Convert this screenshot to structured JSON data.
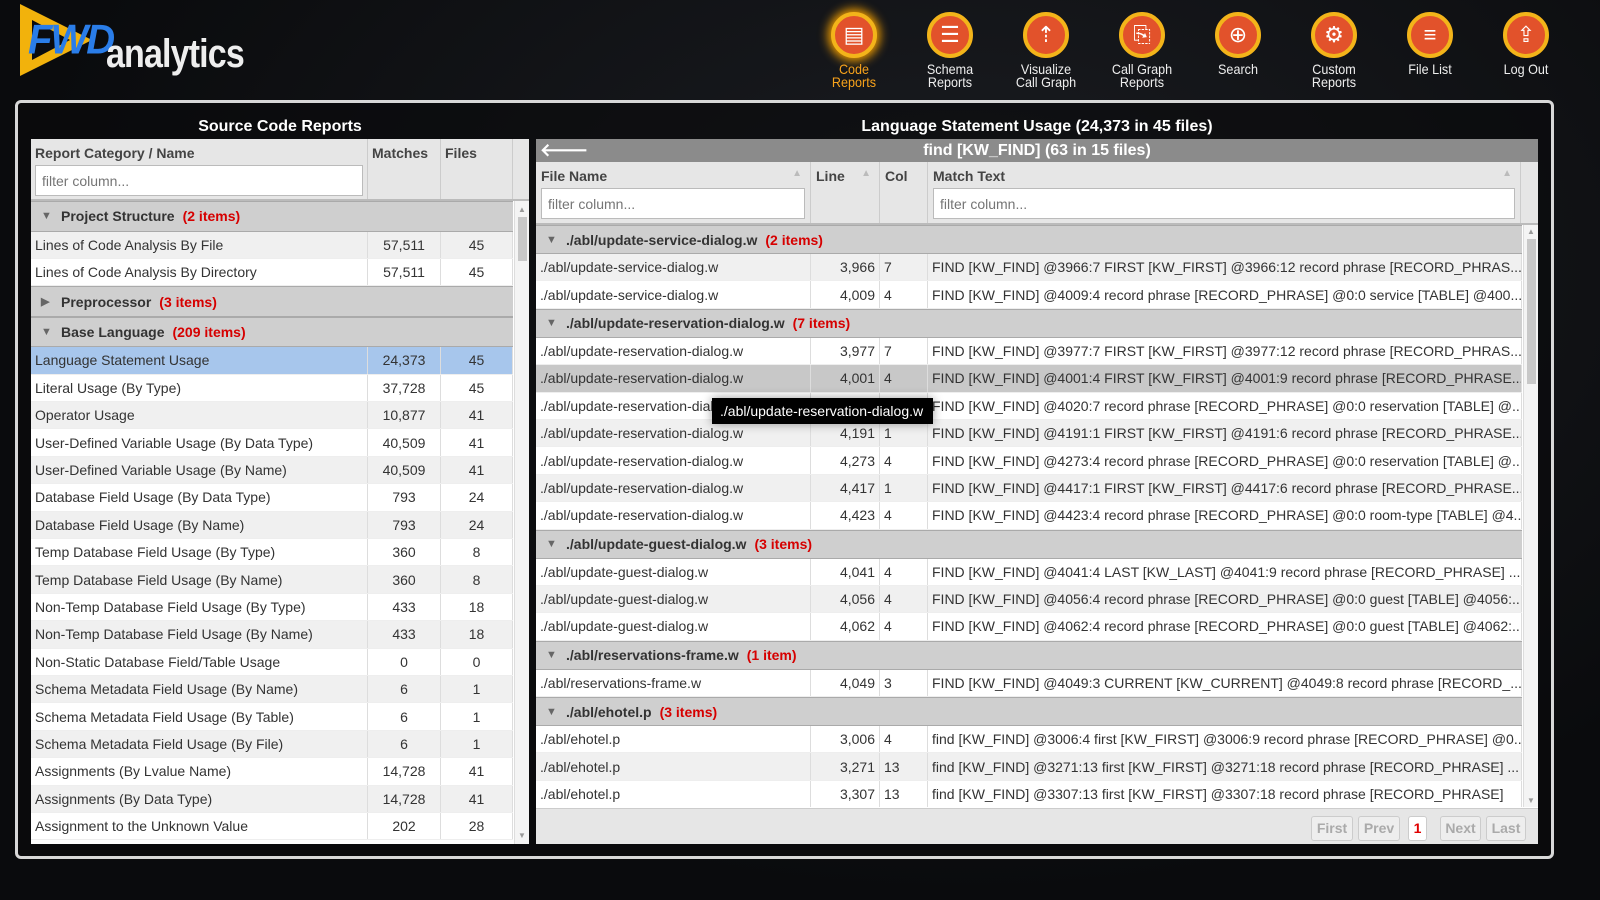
{
  "logo": {
    "brand": "FWD",
    "product": "analytics"
  },
  "nav": [
    {
      "label": "Code\nReports",
      "icon": "document-icon",
      "active": true
    },
    {
      "label": "Schema\nReports",
      "icon": "database-icon"
    },
    {
      "label": "Visualize\nCall Graph",
      "icon": "call-graph-icon"
    },
    {
      "label": "Call Graph\nReports",
      "icon": "call-graph-report-icon"
    },
    {
      "label": "Search",
      "icon": "crosshair-icon"
    },
    {
      "label": "Custom\nReports",
      "icon": "gear-icon"
    },
    {
      "label": "File List",
      "icon": "list-icon"
    },
    {
      "label": "Log Out",
      "icon": "logout-icon"
    }
  ],
  "left": {
    "title": "Source Code Reports",
    "columns": [
      "Report Category / Name",
      "Matches",
      "Files"
    ],
    "filter_placeholder": "filter column...",
    "rows": [
      {
        "group": "Project Structure",
        "count": "(2 items)",
        "expanded": true
      },
      {
        "name": "Lines of Code Analysis By File",
        "matches": "57,511",
        "files": "45"
      },
      {
        "name": "Lines of Code Analysis By Directory",
        "matches": "57,511",
        "files": "45"
      },
      {
        "group": "Preprocessor",
        "count": "(3 items)",
        "expanded": false
      },
      {
        "group": "Base Language",
        "count": "(209 items)",
        "expanded": true
      },
      {
        "name": "Language Statement Usage",
        "matches": "24,373",
        "files": "45",
        "selected": true
      },
      {
        "name": "Literal Usage (By Type)",
        "matches": "37,728",
        "files": "45"
      },
      {
        "name": "Operator Usage",
        "matches": "10,877",
        "files": "41"
      },
      {
        "name": "User-Defined Variable Usage (By Data Type)",
        "matches": "40,509",
        "files": "41"
      },
      {
        "name": "User-Defined Variable Usage (By Name)",
        "matches": "40,509",
        "files": "41"
      },
      {
        "name": "Database Field Usage (By Data Type)",
        "matches": "793",
        "files": "24"
      },
      {
        "name": "Database Field Usage (By Name)",
        "matches": "793",
        "files": "24"
      },
      {
        "name": "Temp Database Field Usage (By Type)",
        "matches": "360",
        "files": "8"
      },
      {
        "name": "Temp Database Field Usage (By Name)",
        "matches": "360",
        "files": "8"
      },
      {
        "name": "Non-Temp Database Field Usage (By Type)",
        "matches": "433",
        "files": "18"
      },
      {
        "name": "Non-Temp Database Field Usage (By Name)",
        "matches": "433",
        "files": "18"
      },
      {
        "name": "Non-Static Database Field/Table Usage",
        "matches": "0",
        "files": "0"
      },
      {
        "name": "Schema Metadata Field Usage (By Name)",
        "matches": "6",
        "files": "1"
      },
      {
        "name": "Schema Metadata Field Usage (By Table)",
        "matches": "6",
        "files": "1"
      },
      {
        "name": "Schema Metadata Field Usage (By File)",
        "matches": "6",
        "files": "1"
      },
      {
        "name": "Assignments (By Lvalue Name)",
        "matches": "14,728",
        "files": "41"
      },
      {
        "name": "Assignments (By Data Type)",
        "matches": "14,728",
        "files": "41"
      },
      {
        "name": "Assignment to the Unknown Value",
        "matches": "202",
        "files": "28"
      }
    ]
  },
  "right": {
    "title": "Language Statement Usage (24,373 in 45 files)",
    "subtitle": "find [KW_FIND] (63 in 15 files)",
    "back_icon": "back-arrow-icon",
    "columns": [
      "File Name",
      "Line",
      "Col",
      "Match Text"
    ],
    "filter_placeholder": "filter column...",
    "tooltip": "./abl/update-reservation-dialog.w",
    "groups": [
      {
        "name": "./abl/update-service-dialog.w",
        "count": "(2 items)",
        "rows": [
          [
            "./abl/update-service-dialog.w",
            "3,966",
            "7",
            "FIND [KW_FIND] @3966:7 FIRST [KW_FIRST] @3966:12 record phrase [RECORD_PHRAS..."
          ],
          [
            "./abl/update-service-dialog.w",
            "4,009",
            "4",
            "FIND [KW_FIND] @4009:4 record phrase [RECORD_PHRASE] @0:0 service [TABLE] @400..."
          ]
        ]
      },
      {
        "name": "./abl/update-reservation-dialog.w",
        "count": "(7 items)",
        "rows": [
          [
            "./abl/update-reservation-dialog.w",
            "3,977",
            "7",
            "FIND [KW_FIND] @3977:7 FIRST [KW_FIRST] @3977:12 record phrase [RECORD_PHRAS..."
          ],
          [
            "./abl/update-reservation-dialog.w",
            "4,001",
            "4",
            "FIND [KW_FIND] @4001:4 FIRST [KW_FIRST] @4001:9 record phrase [RECORD_PHRASE..."
          ],
          [
            "./abl/update-reservation-dialog.w",
            "4,020",
            "7",
            "FIND [KW_FIND] @4020:7 record phrase [RECORD_PHRASE] @0:0 reservation [TABLE] @..."
          ],
          [
            "./abl/update-reservation-dialog.w",
            "4,191",
            "1",
            "FIND [KW_FIND] @4191:1 FIRST [KW_FIRST] @4191:6 record phrase [RECORD_PHRASE..."
          ],
          [
            "./abl/update-reservation-dialog.w",
            "4,273",
            "4",
            "FIND [KW_FIND] @4273:4 record phrase [RECORD_PHRASE] @0:0 reservation [TABLE] @..."
          ],
          [
            "./abl/update-reservation-dialog.w",
            "4,417",
            "1",
            "FIND [KW_FIND] @4417:1 FIRST [KW_FIRST] @4417:6 record phrase [RECORD_PHRASE..."
          ],
          [
            "./abl/update-reservation-dialog.w",
            "4,423",
            "4",
            "FIND [KW_FIND] @4423:4 record phrase [RECORD_PHRASE] @0:0 room-type [TABLE] @4..."
          ]
        ]
      },
      {
        "name": "./abl/update-guest-dialog.w",
        "count": "(3 items)",
        "rows": [
          [
            "./abl/update-guest-dialog.w",
            "4,041",
            "4",
            "FIND [KW_FIND] @4041:4 LAST [KW_LAST] @4041:9 record phrase [RECORD_PHRASE] ..."
          ],
          [
            "./abl/update-guest-dialog.w",
            "4,056",
            "4",
            "FIND [KW_FIND] @4056:4 record phrase [RECORD_PHRASE] @0:0 guest [TABLE] @4056:..."
          ],
          [
            "./abl/update-guest-dialog.w",
            "4,062",
            "4",
            "FIND [KW_FIND] @4062:4 record phrase [RECORD_PHRASE] @0:0 guest [TABLE] @4062:..."
          ]
        ]
      },
      {
        "name": "./abl/reservations-frame.w",
        "count": "(1 item)",
        "rows": [
          [
            "./abl/reservations-frame.w",
            "4,049",
            "3",
            "FIND [KW_FIND] @4049:3 CURRENT [KW_CURRENT] @4049:8 record phrase [RECORD_..."
          ]
        ]
      },
      {
        "name": "./abl/ehotel.p",
        "count": "(3 items)",
        "rows": [
          [
            "./abl/ehotel.p",
            "3,006",
            "4",
            "find [KW_FIND] @3006:4 first [KW_FIRST] @3006:9 record phrase [RECORD_PHRASE] @0..."
          ],
          [
            "./abl/ehotel.p",
            "3,271",
            "13",
            "find [KW_FIND] @3271:13 first [KW_FIRST] @3271:18 record phrase [RECORD_PHRASE] ..."
          ],
          [
            "./abl/ehotel.p",
            "3,307",
            "13",
            "find [KW_FIND] @3307:13 first [KW_FIRST] @3307:18 record phrase [RECORD_PHRASE]"
          ]
        ]
      }
    ],
    "pager": {
      "first": "First",
      "prev": "Prev",
      "page": "1",
      "next": "Next",
      "last": "Last"
    }
  }
}
